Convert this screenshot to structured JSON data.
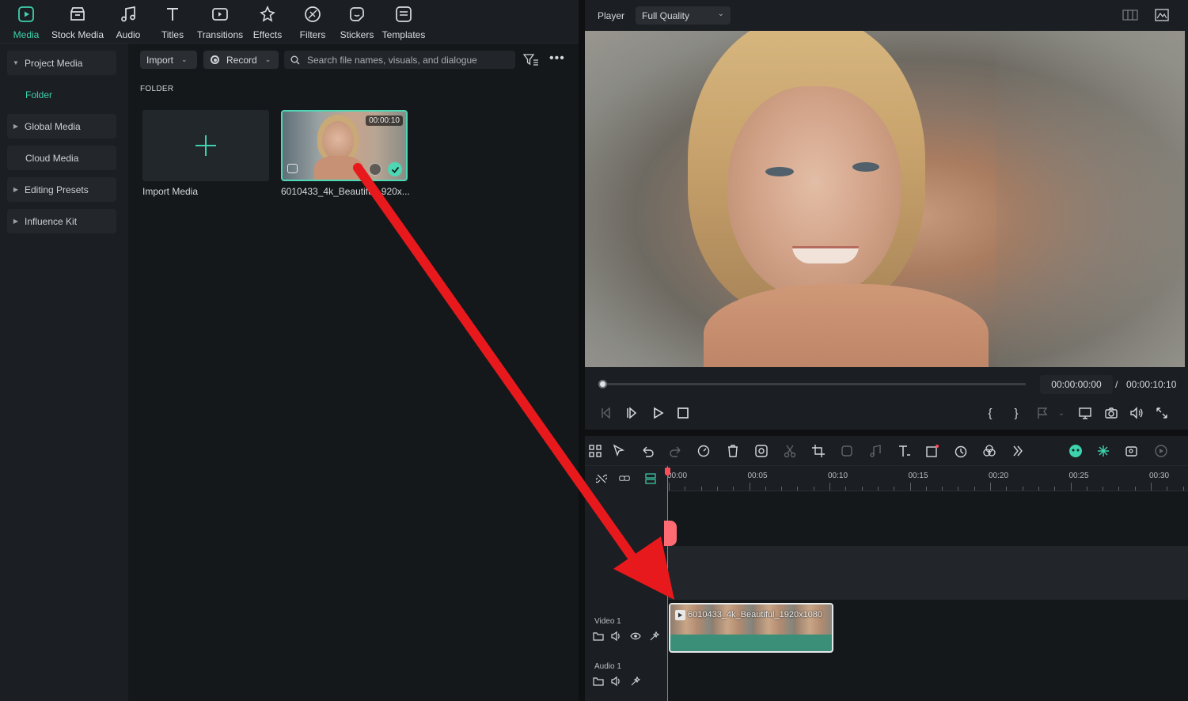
{
  "tabs": [
    {
      "label": "Media",
      "icon": "media-icon",
      "active": true
    },
    {
      "label": "Stock Media",
      "icon": "stock-media-icon"
    },
    {
      "label": "Audio",
      "icon": "music-note-icon"
    },
    {
      "label": "Titles",
      "icon": "text-t-icon"
    },
    {
      "label": "Transitions",
      "icon": "transitions-icon"
    },
    {
      "label": "Effects",
      "icon": "sparkle-icon"
    },
    {
      "label": "Filters",
      "icon": "filters-icon"
    },
    {
      "label": "Stickers",
      "icon": "sticker-icon"
    },
    {
      "label": "Templates",
      "icon": "templates-icon"
    }
  ],
  "sidebar": {
    "project_media": "Project Media",
    "folder": "Folder",
    "global_media": "Global Media",
    "cloud_media": "Cloud Media",
    "editing_presets": "Editing Presets",
    "influence_kit": "Influence Kit"
  },
  "media_toolbar": {
    "import_label": "Import",
    "record_label": "Record",
    "search_placeholder": "Search file names, visuals, and dialogue"
  },
  "media_area": {
    "folder_heading": "FOLDER",
    "import_card_label": "Import Media",
    "clip_name": "6010433_4k_Beautifu...920x...",
    "clip_duration": "00:00:10"
  },
  "player": {
    "label": "Player",
    "quality": "Full Quality",
    "current_time": "00:00:00:00",
    "separator": "/",
    "total_time": "00:00:10:10",
    "progress_fraction": 0.0
  },
  "timeline": {
    "ruler_labels": [
      "00:00",
      "00:05",
      "00:10",
      "00:15",
      "00:20",
      "00:25",
      "00:30"
    ],
    "tracks": {
      "video_label": "Video 1",
      "audio_label": "Audio 1"
    },
    "clip_title": "6010433_4k_Beautiful_1920x1080"
  },
  "colors": {
    "accent": "#3ed1ad",
    "playhead": "#ff4d5a",
    "clip": "#3b8f79",
    "annotation_arrow": "#e8191c"
  }
}
